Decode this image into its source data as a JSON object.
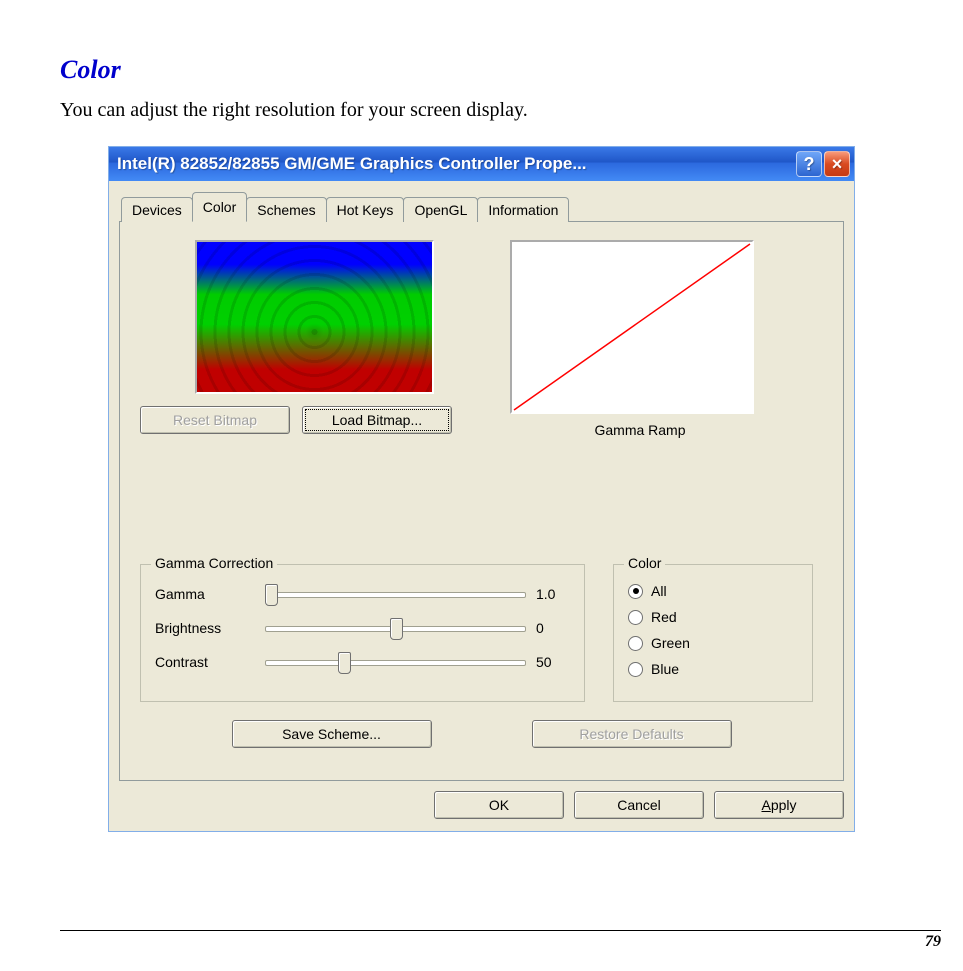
{
  "doc": {
    "section_title": "Color",
    "section_desc": "You can adjust the right resolution for your screen display.",
    "page_number": "79"
  },
  "window": {
    "title": "Intel(R) 82852/82855 GM/GME Graphics Controller Prope...",
    "help_btn": "?",
    "close_btn": "×",
    "tabs": [
      "Devices",
      "Color",
      "Schemes",
      "Hot Keys",
      "OpenGL",
      "Information"
    ],
    "active_tab": "Color",
    "buttons": {
      "reset_bitmap": "Reset Bitmap",
      "load_bitmap": "Load Bitmap...",
      "save_scheme": "Save Scheme...",
      "restore_defaults": "Restore Defaults",
      "ok": "OK",
      "cancel": "Cancel",
      "apply": "Apply"
    },
    "gamma_ramp_label": "Gamma Ramp",
    "gamma_group": {
      "legend": "Gamma Correction",
      "rows": [
        {
          "label": "Gamma",
          "value": "1.0",
          "pos": 0
        },
        {
          "label": "Brightness",
          "value": "0",
          "pos": 50
        },
        {
          "label": "Contrast",
          "value": "50",
          "pos": 28
        }
      ]
    },
    "color_group": {
      "legend": "Color",
      "options": [
        "All",
        "Red",
        "Green",
        "Blue"
      ],
      "selected": "All"
    }
  }
}
